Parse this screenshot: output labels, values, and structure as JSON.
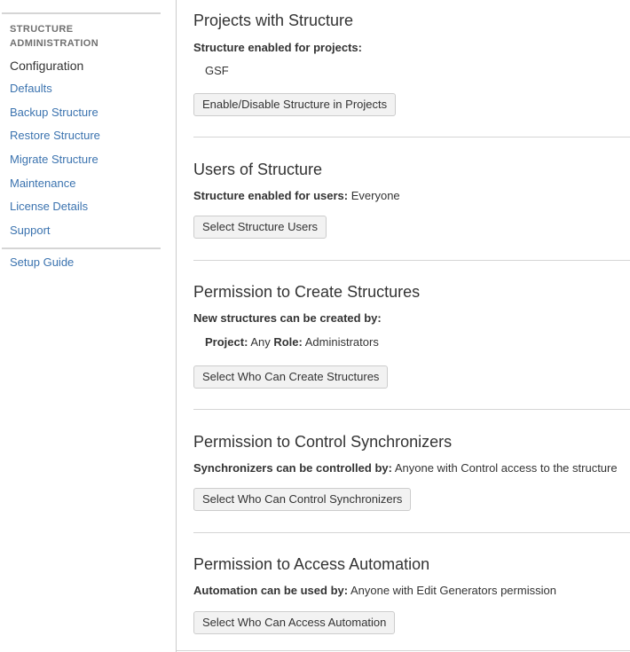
{
  "sidebar": {
    "heading_line1": "STRUCTURE",
    "heading_line2": "ADMINISTRATION",
    "items": [
      {
        "label": "Configuration",
        "active": true
      },
      {
        "label": "Defaults"
      },
      {
        "label": "Backup Structure"
      },
      {
        "label": "Restore Structure"
      },
      {
        "label": "Migrate Structure"
      },
      {
        "label": "Maintenance"
      },
      {
        "label": "License Details"
      },
      {
        "label": "Support"
      }
    ],
    "extra_items": [
      {
        "label": "Setup Guide"
      }
    ]
  },
  "sections": {
    "projects": {
      "title": "Projects with Structure",
      "label": "Structure enabled for projects:",
      "value": "GSF",
      "button": "Enable/Disable Structure in Projects"
    },
    "users": {
      "title": "Users of Structure",
      "label": "Structure enabled for users:",
      "value": "Everyone",
      "button": "Select Structure Users"
    },
    "create": {
      "title": "Permission to Create Structures",
      "label": "New structures can be created by:",
      "project_label": "Project:",
      "project_value": "Any",
      "role_label": "Role:",
      "role_value": "Administrators",
      "button": "Select Who Can Create Structures"
    },
    "synchronizers": {
      "title": "Permission to Control Synchronizers",
      "label": "Synchronizers can be controlled by:",
      "value": "Anyone with Control access to the structure",
      "button": "Select Who Can Control Synchronizers"
    },
    "automation": {
      "title": "Permission to Access Automation",
      "label": "Automation can be used by:",
      "value": "Anyone with Edit Generators permission",
      "button": "Select Who Can Access Automation"
    }
  }
}
